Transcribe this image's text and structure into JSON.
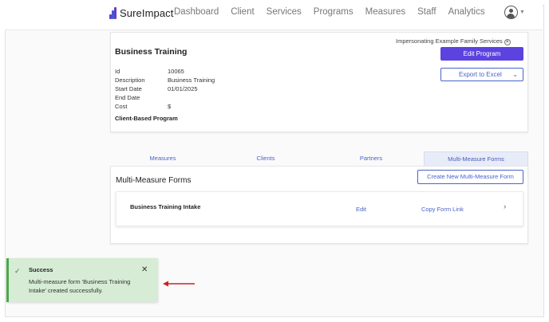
{
  "brand": {
    "name": "SureImpact"
  },
  "nav": {
    "items": [
      "Dashboard",
      "Client",
      "Services",
      "Programs",
      "Measures",
      "Staff",
      "Analytics"
    ]
  },
  "impersonating": {
    "text": "Impersonating Example Family Services"
  },
  "program": {
    "title": "Business Training",
    "fields": [
      {
        "label": "Id",
        "value": "10065"
      },
      {
        "label": "Description",
        "value": "Business Training"
      },
      {
        "label": "Start Date",
        "value": "01/01/2025"
      },
      {
        "label": "End Date",
        "value": ""
      },
      {
        "label": "Cost",
        "value": "$"
      }
    ],
    "type_label": "Client-Based Program",
    "edit_label": "Edit Program",
    "export_label": "Export to Excel"
  },
  "tabs": [
    {
      "label": "Measures",
      "active": false
    },
    {
      "label": "Clients",
      "active": false
    },
    {
      "label": "Partners",
      "active": false
    },
    {
      "label": "Multi-Measure Forms",
      "active": true
    }
  ],
  "mmf": {
    "title": "Multi-Measure Forms",
    "create_label": "Create New Multi-Measure Form",
    "forms": [
      {
        "name": "Business Training Intake",
        "edit_label": "Edit",
        "copy_label": "Copy Form Link"
      }
    ]
  },
  "toast": {
    "title": "Success",
    "message": "Multi-measure form 'Business Training Intake' created successfully."
  },
  "colors": {
    "accent": "#5c43e0",
    "link": "#4a64c8",
    "success_bg": "#d6ecd4",
    "annotation_arrow": "#cc2222"
  }
}
